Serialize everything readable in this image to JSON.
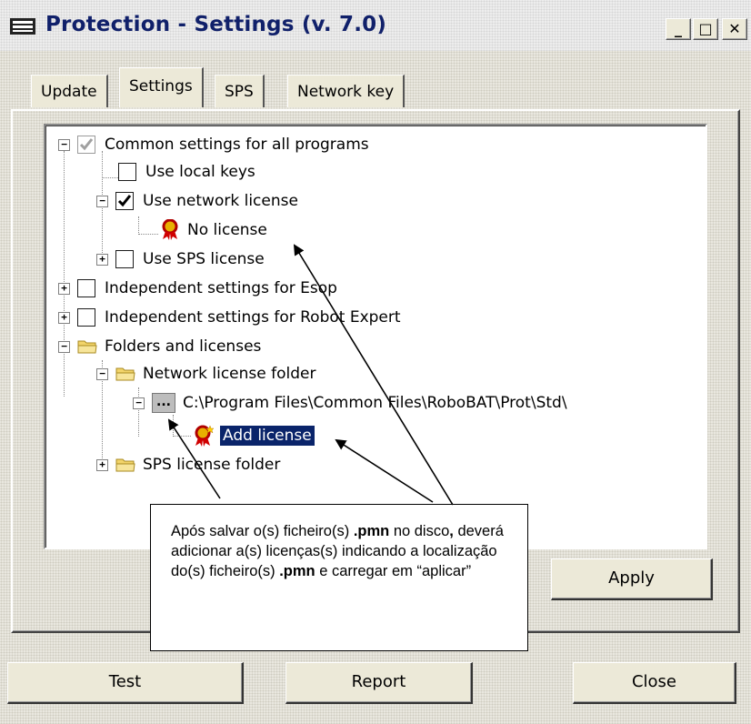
{
  "window": {
    "title": "Protection - Settings (v. 7.0)",
    "controls": {
      "minimize": "_",
      "maximize": "□",
      "close": "✕"
    }
  },
  "tabs": [
    {
      "label": "Update",
      "active": false
    },
    {
      "label": "Settings",
      "active": true
    },
    {
      "label": "SPS",
      "active": false
    },
    {
      "label": "Network key",
      "active": false
    }
  ],
  "tree": {
    "common": "Common settings for all programs",
    "local_keys": "Use local keys",
    "network_license": "Use network license",
    "no_license": "No license",
    "sps_license": "Use SPS license",
    "esop": "Independent settings for Esop",
    "robot_expert": "Independent settings for Robot Expert",
    "folders_licenses": "Folders and licenses",
    "network_folder": "Network license folder",
    "path": "C:\\Program Files\\Common Files\\RoboBAT\\Prot\\Std\\",
    "add_license": "Add license",
    "sps_folder": "SPS license folder"
  },
  "buttons": {
    "apply": "Apply",
    "test": "Test",
    "report": "Report",
    "close": "Close"
  },
  "callout": {
    "part1": "Após salvar o(s) ficheiro(s) ",
    "bold1": ".pmn",
    "part2": " no disco",
    "bold_comma": ",",
    "part3": " deverá adicionar a(s) licenças(s) indicando a localização do(s) ficheiro(s) ",
    "bold2": ".pmn",
    "part4": " e carregar em “aplicar”"
  },
  "colors": {
    "title_text": "#10206a",
    "selection": "#0a246a",
    "window_bg": "#ece9d8"
  }
}
